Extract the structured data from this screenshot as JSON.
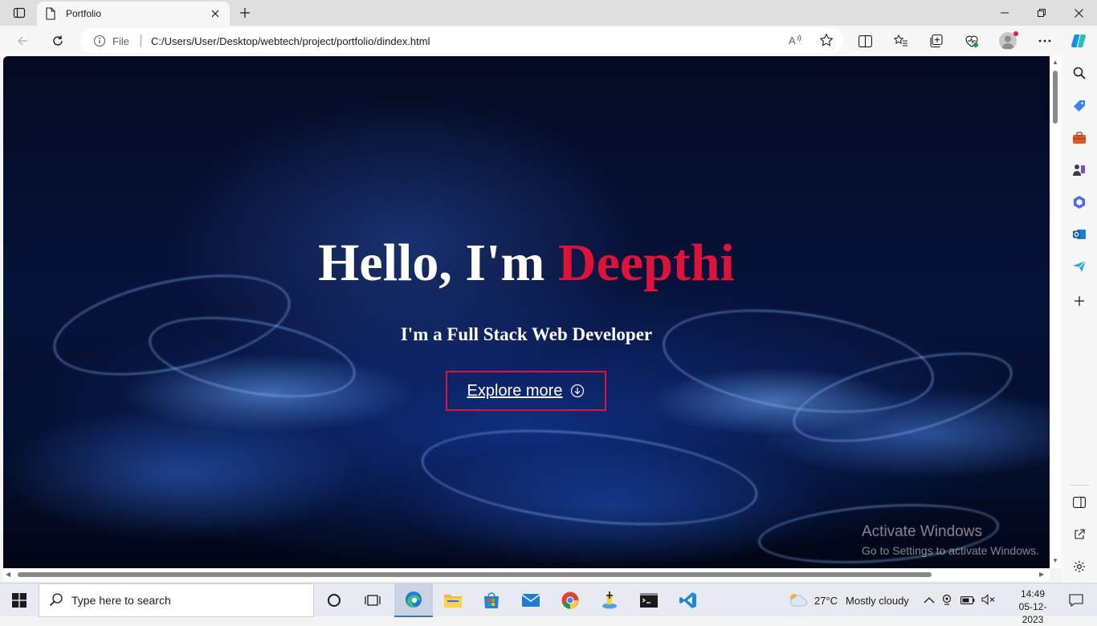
{
  "browser": {
    "tab": {
      "title": "Portfolio"
    },
    "address": {
      "scheme_label": "File",
      "url": "C:/Users/User/Desktop/webtech/project/portfolio/dindex.html"
    }
  },
  "page": {
    "hero": {
      "greeting": "Hello, I'm ",
      "name": "Deepthi",
      "subtitle": "I'm a Full Stack Web Developer",
      "button_label": "Explore more"
    },
    "accent_color": "#dc143c"
  },
  "watermark": {
    "title": "Activate Windows",
    "subtitle": "Go to Settings to activate Windows."
  },
  "taskbar": {
    "search_placeholder": "Type here to search",
    "weather": {
      "temperature": "27°C",
      "condition": "Mostly cloudy"
    },
    "clock": {
      "time": "14:49",
      "date": "05-12-2023"
    }
  }
}
